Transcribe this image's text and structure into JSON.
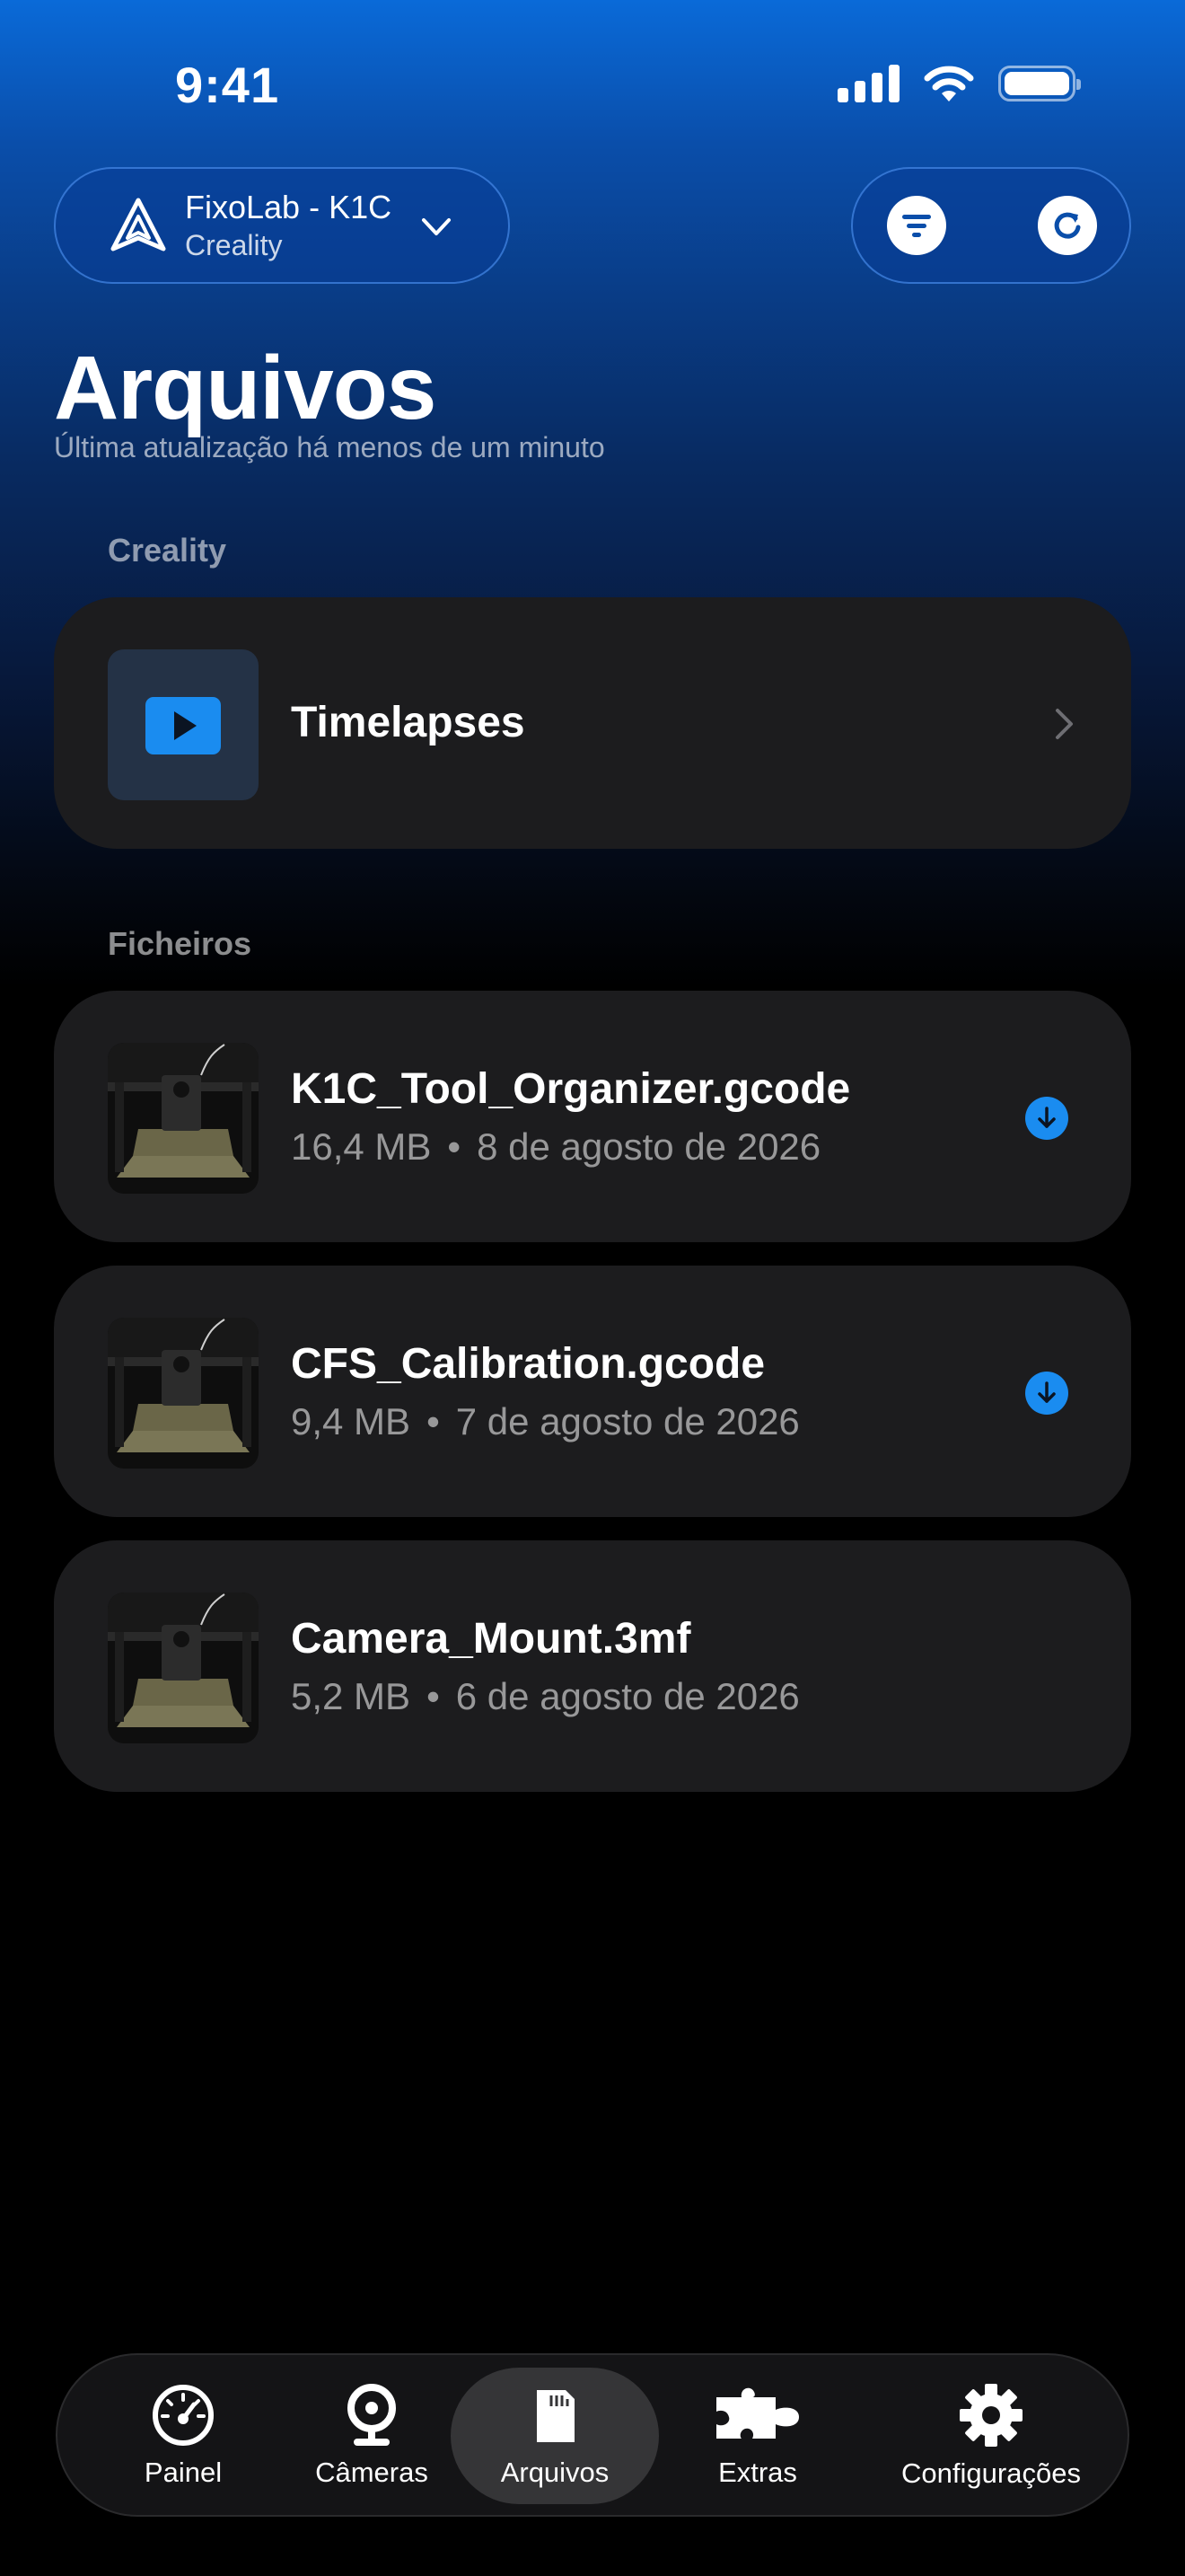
{
  "status_bar": {
    "time": "9:41"
  },
  "header": {
    "printer_name": "FixoLab - K1C",
    "printer_brand": "Creality"
  },
  "page": {
    "title": "Arquivos",
    "subtitle": "Última atualização há menos de um minuto"
  },
  "sections": {
    "creality_label": "Creality",
    "timelapses_label": "Timelapses",
    "files_label": "Ficheiros"
  },
  "files": [
    {
      "name": "K1C_Tool_Organizer.gcode",
      "size": "16,4 MB",
      "date": "8 de agosto de 2026",
      "downloadable": true
    },
    {
      "name": "CFS_Calibration.gcode",
      "size": "9,4 MB",
      "date": "7 de agosto de 2026",
      "downloadable": true
    },
    {
      "name": "Camera_Mount.3mf",
      "size": "5,2 MB",
      "date": "6 de agosto de 2026",
      "downloadable": false
    }
  ],
  "separator": "•",
  "tabs": [
    {
      "label": "Painel",
      "icon": "gauge-icon"
    },
    {
      "label": "Câmeras",
      "icon": "webcam-icon"
    },
    {
      "label": "Arquivos",
      "icon": "sd-card-icon",
      "active": true
    },
    {
      "label": "Extras",
      "icon": "puzzle-icon"
    },
    {
      "label": "Configurações",
      "icon": "gear-icon"
    }
  ],
  "colors": {
    "accent": "#1a8cf0",
    "card": "#1c1c1e",
    "active_tab": "#353537"
  }
}
